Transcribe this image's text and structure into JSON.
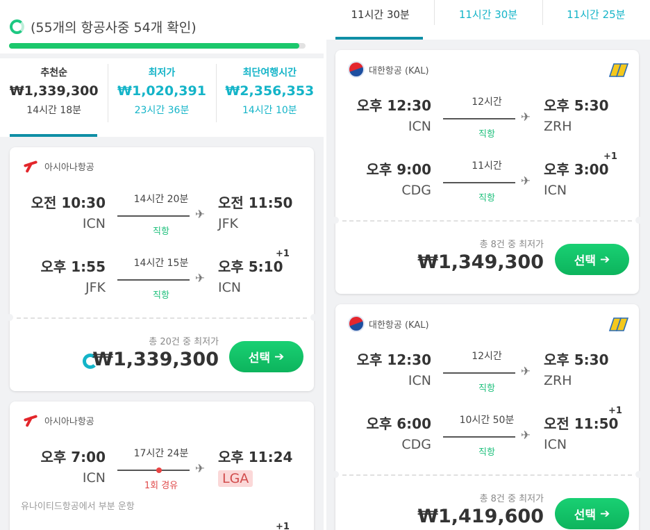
{
  "left": {
    "progress": {
      "text": "(55개의 항공사중 54개 확인)",
      "fraction": 0.98
    },
    "sort_tabs": [
      {
        "title": "추천순",
        "price": "₩1,339,300",
        "duration": "14시간 18분"
      },
      {
        "title": "최저가",
        "price": "₩1,020,391",
        "duration": "23시간 36분"
      },
      {
        "title": "최단여행시간",
        "price": "₩2,356,353",
        "duration": "14시간 10분"
      }
    ],
    "cards": [
      {
        "airline": "아시아나항공",
        "legs": [
          {
            "dep_time": "오전 10:30",
            "dep_apt": "ICN",
            "duration": "14시간 20분",
            "stops": "직항",
            "arr_time": "오전 11:50",
            "arr_apt": "JFK",
            "plus": ""
          },
          {
            "dep_time": "오후 1:55",
            "dep_apt": "JFK",
            "duration": "14시간 15분",
            "stops": "직항",
            "arr_time": "오후 5:10",
            "arr_apt": "ICN",
            "plus": "+1"
          }
        ],
        "count": "총 20건 중 최저가",
        "price": "₩1,339,300",
        "select_label": "선택"
      },
      {
        "airline": "아시아나항공",
        "legs": [
          {
            "dep_time": "오후 7:00",
            "dep_apt": "ICN",
            "duration": "17시간 24분",
            "stops": "1회 경유",
            "arr_time": "오후 11:24",
            "arr_apt": "LGA",
            "plus": ""
          }
        ],
        "note": "유나이티드항공에서 부분 운항",
        "next_plus": "+1"
      }
    ]
  },
  "right": {
    "tabs": [
      "11시간 30분",
      "11시간 30분",
      "11시간 25분"
    ],
    "cards": [
      {
        "airline": "대한항공 (KAL)",
        "legs": [
          {
            "dep_time": "오후 12:30",
            "dep_apt": "ICN",
            "duration": "12시간",
            "stops": "직항",
            "arr_time": "오후 5:30",
            "arr_apt": "ZRH",
            "plus": ""
          },
          {
            "dep_time": "오후 9:00",
            "dep_apt": "CDG",
            "duration": "11시간",
            "stops": "직항",
            "arr_time": "오후 3:00",
            "arr_apt": "ICN",
            "plus": "+1"
          }
        ],
        "count": "총 8건 중 최저가",
        "price": "₩1,349,300",
        "select_label": "선택"
      },
      {
        "airline": "대한항공 (KAL)",
        "legs": [
          {
            "dep_time": "오후 12:30",
            "dep_apt": "ICN",
            "duration": "12시간",
            "stops": "직항",
            "arr_time": "오후 5:30",
            "arr_apt": "ZRH",
            "plus": ""
          },
          {
            "dep_time": "오후 6:00",
            "dep_apt": "CDG",
            "duration": "10시간 50분",
            "stops": "직항",
            "arr_time": "오전 11:50",
            "arr_apt": "ICN",
            "plus": "+1"
          }
        ],
        "count": "총 8건 중 최저가",
        "price": "₩1,419,600",
        "select_label": "선택"
      }
    ]
  },
  "colors": {
    "accent": "#14b4c8",
    "green": "#1bc86c",
    "red": "#e3262b"
  },
  "icons": [
    "spinner-icon",
    "plane-icon",
    "arrow-right-icon",
    "asiana-logo-icon",
    "kal-logo-icon",
    "premium-badge-icon"
  ]
}
